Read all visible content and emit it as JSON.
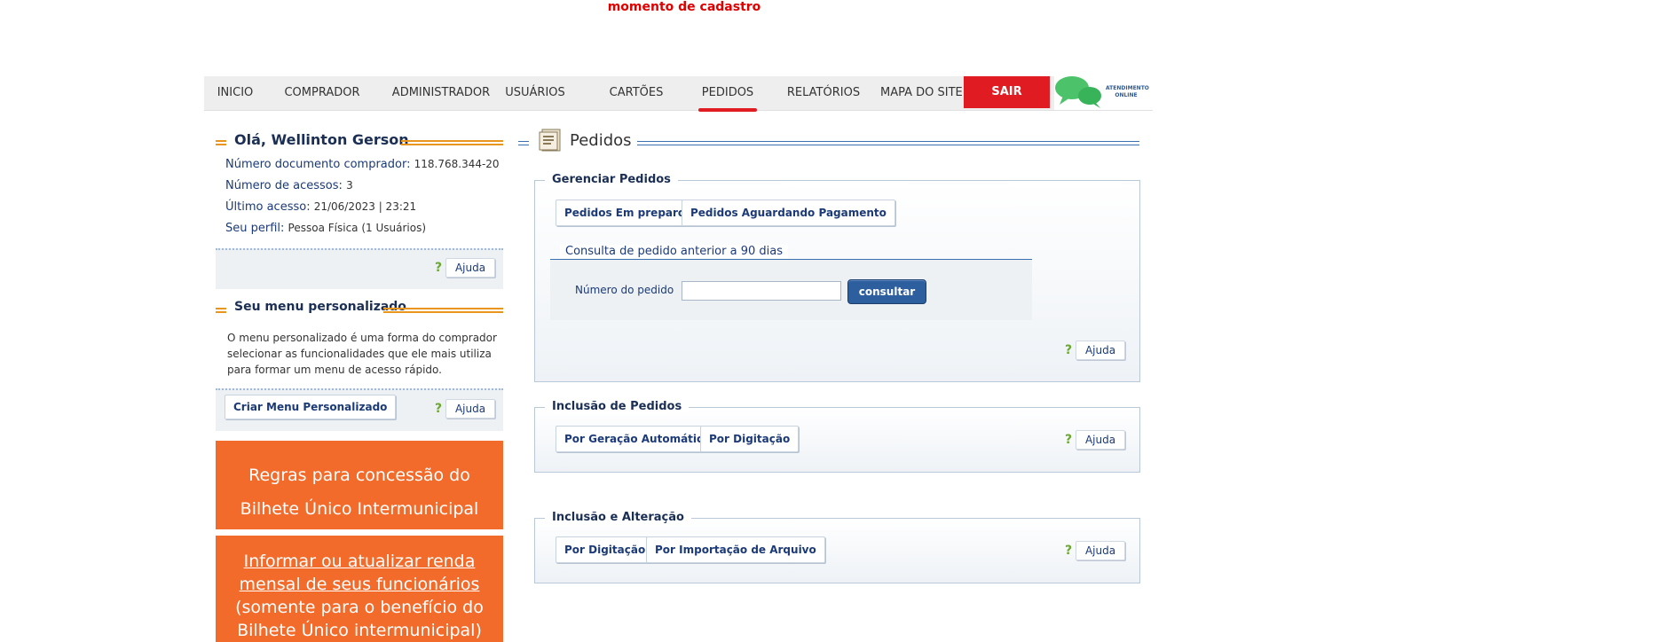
{
  "header": {
    "message": "momento de cadastro"
  },
  "nav": {
    "items": [
      "INICIO",
      "COMPRADOR",
      "ADMINISTRADOR",
      "USUÁRIOS",
      "CARTÕES",
      "PEDIDOS",
      "RELATÓRIOS",
      "MAPA DO SITE"
    ],
    "active": "PEDIDOS",
    "logout": "SAIR",
    "chat_label": "ATENDIMENTO ONLINE"
  },
  "user": {
    "greeting": "Olá, Wellinton Gerson",
    "doc_label": "Número documento comprador:",
    "doc_value": "118.768.344-20",
    "access_label": "Número de acessos:",
    "access_value": "3",
    "last_label": "Último acesso:",
    "last_value": "21/06/2023 | 23:21",
    "profile_label": "Seu perfil:",
    "profile_value": "Pessoa Física (1 Usuários)",
    "help": "Ajuda"
  },
  "custom_menu": {
    "title": "Seu menu personalizado",
    "description": "O menu personalizado é uma forma do comprador selecionar as funcionalidades que ele mais utiliza para formar um menu de acesso rápido.",
    "create_button": "Criar Menu Personalizado",
    "help": "Ajuda"
  },
  "banners": {
    "rules_line1": "Regras para concessão do",
    "rules_line2": "Bilhete Único Intermunicipal",
    "income_link_line1": "Informar ou atualizar renda",
    "income_link_line2": "mensal de seus funcionários",
    "income_note_line1": "(somente para o benefício do",
    "income_note_line2": "Bilhete Único intermunicipal)"
  },
  "main": {
    "title": "Pedidos",
    "manage": {
      "legend": "Gerenciar Pedidos",
      "btn_preparing": "Pedidos Em preparo",
      "btn_awaiting": "Pedidos Aguardando Pagamento",
      "lookup_legend": "Consulta de pedido anterior a 90 dias",
      "order_label": "Número do pedido",
      "order_value": "",
      "consult_button": "consultar",
      "help": "Ajuda"
    },
    "inclusion": {
      "legend": "Inclusão de Pedidos",
      "btn_auto": "Por Geração Automática",
      "btn_typing": "Por Digitação",
      "help": "Ajuda"
    },
    "alteration": {
      "legend": "Inclusão e Alteração",
      "btn_typing": "Por Digitação",
      "btn_import": "Por Importação de Arquivo",
      "help": "Ajuda"
    }
  }
}
